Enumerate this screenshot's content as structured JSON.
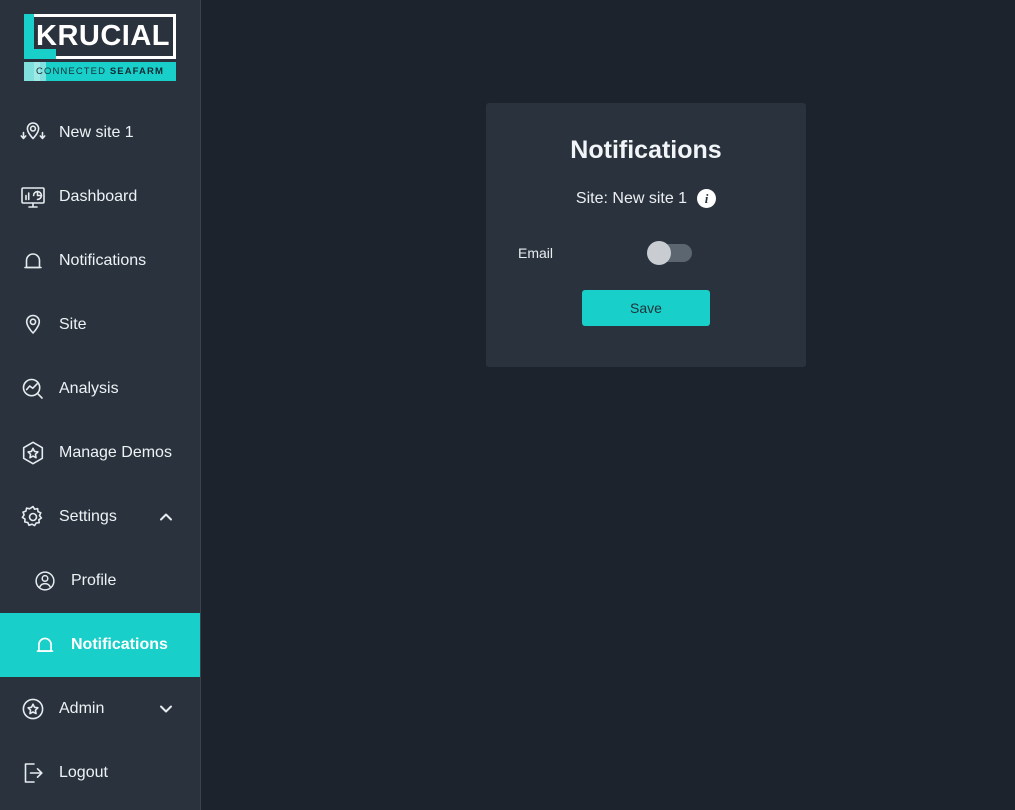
{
  "brand": {
    "name": "KRUCIAL",
    "tagline_regular": "CONNECTED ",
    "tagline_bold": "SEAFARM",
    "accent_color": "#19cfc9"
  },
  "sidebar": {
    "items": [
      {
        "label": "New site 1",
        "icon": "map-pin-download-icon",
        "active": false,
        "sub": false,
        "chevron": ""
      },
      {
        "label": "Dashboard",
        "icon": "dashboard-monitor-icon",
        "active": false,
        "sub": false,
        "chevron": ""
      },
      {
        "label": "Notifications",
        "icon": "bell-icon",
        "active": false,
        "sub": false,
        "chevron": ""
      },
      {
        "label": "Site",
        "icon": "location-pin-icon",
        "active": false,
        "sub": false,
        "chevron": ""
      },
      {
        "label": "Analysis",
        "icon": "chart-search-icon",
        "active": false,
        "sub": false,
        "chevron": ""
      },
      {
        "label": "Manage Demos",
        "icon": "hexagon-star-icon",
        "active": false,
        "sub": false,
        "chevron": ""
      },
      {
        "label": "Settings",
        "icon": "gear-icon",
        "active": false,
        "sub": false,
        "chevron": "up"
      },
      {
        "label": "Profile",
        "icon": "user-circle-icon",
        "active": false,
        "sub": true,
        "chevron": ""
      },
      {
        "label": "Notifications",
        "icon": "bell-icon",
        "active": true,
        "sub": true,
        "chevron": ""
      },
      {
        "label": "Admin",
        "icon": "star-circle-icon",
        "active": false,
        "sub": false,
        "chevron": "down"
      },
      {
        "label": "Logout",
        "icon": "logout-icon",
        "active": false,
        "sub": false,
        "chevron": ""
      }
    ]
  },
  "card": {
    "title": "Notifications",
    "site_label": "Site: New site 1",
    "info_glyph": "i",
    "toggle": {
      "label": "Email",
      "state": "off"
    },
    "save_label": "Save"
  },
  "colors": {
    "background": "#1c232c",
    "panel": "#2a333d",
    "accent": "#19cfc9",
    "text": "#eef2f5"
  }
}
